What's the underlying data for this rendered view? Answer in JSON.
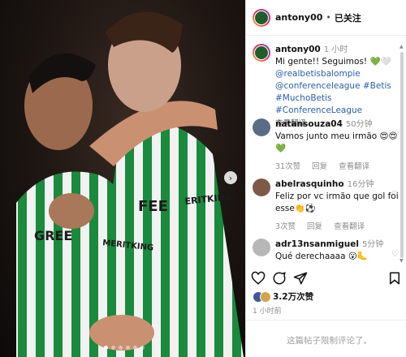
{
  "header": {
    "username": "antony00",
    "separator": "•",
    "follow_label": "已关注"
  },
  "caption": {
    "username": "antony00",
    "time": "1 小时",
    "text": "Mi gente!! Seguimos! 💚🤍",
    "tags": [
      "@realbetisbalompie",
      "@conferenceleague #Betis",
      "#MuchoBetis #ConferenceLeague"
    ],
    "translate": "查看翻译"
  },
  "comments": [
    {
      "username": "natansouza04",
      "time": "50分钟",
      "text": "Vamos junto meu irmão 😍😍",
      "text2": "💚",
      "likes": "31次赞",
      "reply": "回复",
      "translate": "查看翻译"
    },
    {
      "username": "abelrasquinho",
      "time": "16分钟",
      "text": "Feliz por vc irmão que gol foi",
      "text2": "esse👏⚽",
      "likes": "3次赞",
      "reply": "回复",
      "translate": "查看翻译"
    },
    {
      "username": "adr13nsanmiguel",
      "time": "5分钟",
      "text": "Qué derechaaaa 😮🦶"
    }
  ],
  "stats": {
    "likes": "3.2万次赞",
    "posted": "1 小时前"
  },
  "footer": {
    "comments_disabled": "这篇帖子限制评论了。"
  },
  "icons": [
    "heart-icon",
    "comment-icon",
    "share-icon",
    "bookmark-icon",
    "chevron-right-icon"
  ],
  "colors": {
    "link": "#2a5fa8",
    "muted": "#8e8e8e",
    "jersey_green": "#1a8a3c"
  }
}
